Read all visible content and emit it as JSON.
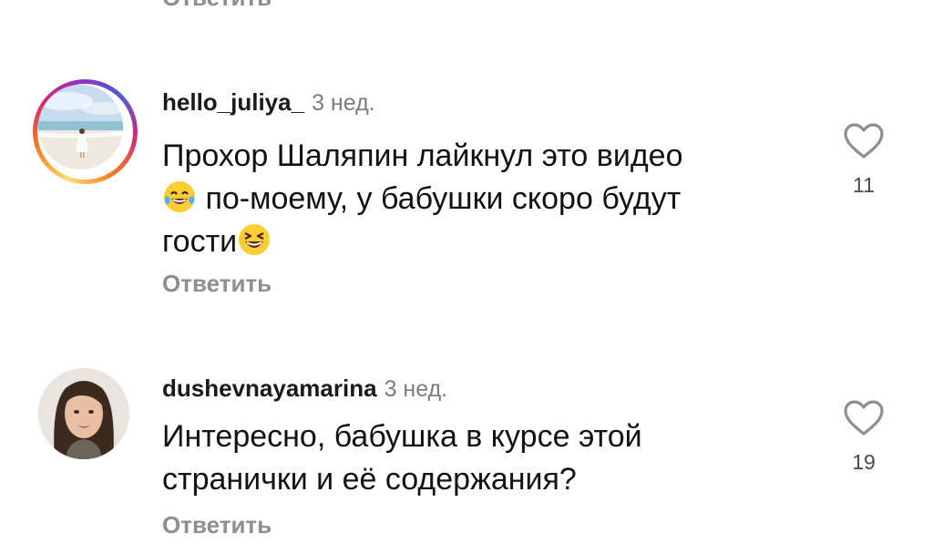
{
  "top_reply": {
    "label": "Ответить"
  },
  "comments": [
    {
      "username": "hello_juliya_",
      "time": "3 нед.",
      "text_line1": "Прохор Шаляпин  лайкнул это видео",
      "text_line2": " по-моему, у бабушки скоро будут",
      "text_line3": "гости",
      "reply_label": "Ответить",
      "likes": "11",
      "avatar": "beach-photo-avatar",
      "has_story_ring": true
    },
    {
      "username": "dushevnayamarina",
      "time": "3 нед.",
      "text_line1": "Интересно, бабушка в курсе этой",
      "text_line2": "странички и её содержания?",
      "reply_label": "Ответить",
      "likes": "19",
      "avatar": "woman-portrait-avatar",
      "has_story_ring": false
    }
  ],
  "icons": {
    "like": "heart-outline-icon",
    "emoji1": "tears-of-joy-emoji",
    "emoji2": "grinning-squinting-emoji"
  },
  "colors": {
    "secondary_text": "#8e8e8e",
    "ring_gradient_start": "#feda75",
    "ring_gradient_end": "#962fbf"
  }
}
